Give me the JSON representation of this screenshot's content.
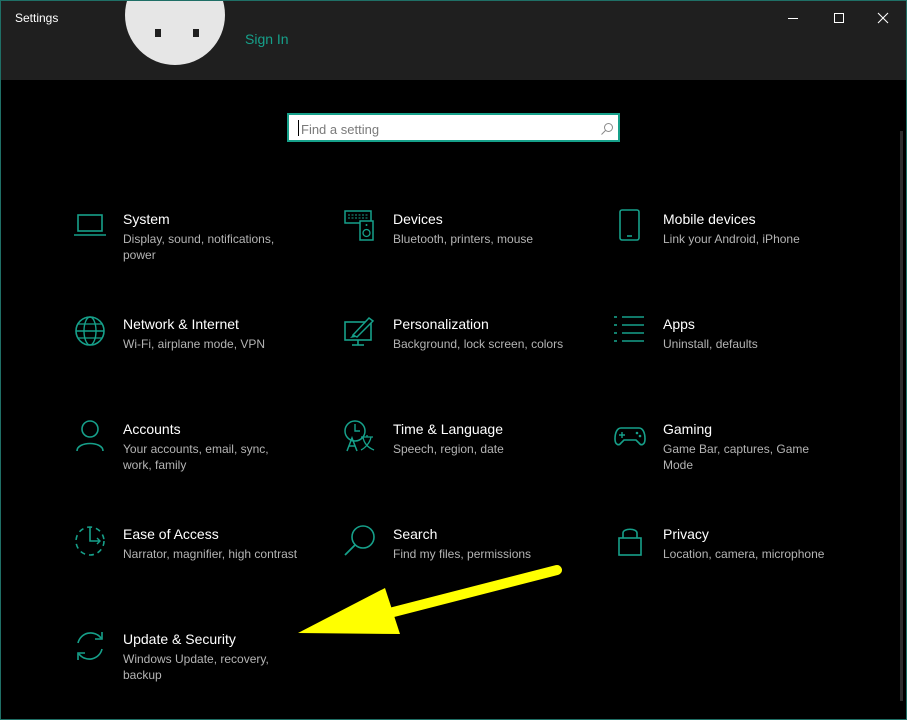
{
  "window": {
    "title": "Settings"
  },
  "account": {
    "sign_in": "Sign In"
  },
  "search": {
    "placeholder": "Find a setting"
  },
  "tiles": [
    {
      "name": "System",
      "desc": "Display, sound, notifications, power"
    },
    {
      "name": "Devices",
      "desc": "Bluetooth, printers, mouse"
    },
    {
      "name": "Mobile devices",
      "desc": "Link your Android, iPhone"
    },
    {
      "name": "Network & Internet",
      "desc": "Wi-Fi, airplane mode, VPN"
    },
    {
      "name": "Personalization",
      "desc": "Background, lock screen, colors"
    },
    {
      "name": "Apps",
      "desc": "Uninstall, defaults"
    },
    {
      "name": "Accounts",
      "desc": "Your accounts, email, sync, work, family"
    },
    {
      "name": "Time & Language",
      "desc": "Speech, region, date"
    },
    {
      "name": "Gaming",
      "desc": "Game Bar, captures, Game Mode"
    },
    {
      "name": "Ease of Access",
      "desc": "Narrator, magnifier, high contrast"
    },
    {
      "name": "Search",
      "desc": "Find my files, permissions"
    },
    {
      "name": "Privacy",
      "desc": "Location, camera, microphone"
    },
    {
      "name": "Update & Security",
      "desc": "Windows Update, recovery, backup"
    }
  ],
  "icons": {
    "accent": "#16a08a",
    "names": [
      "laptop-icon",
      "devices-icon",
      "mobile-phone-icon",
      "globe-icon",
      "personalization-icon",
      "apps-list-icon",
      "person-icon",
      "time-language-icon",
      "game-controller-icon",
      "ease-of-access-icon",
      "search-magnifier-icon",
      "lock-icon",
      "sync-icon"
    ]
  },
  "annotation": {
    "arrow_color": "#ffff00"
  }
}
